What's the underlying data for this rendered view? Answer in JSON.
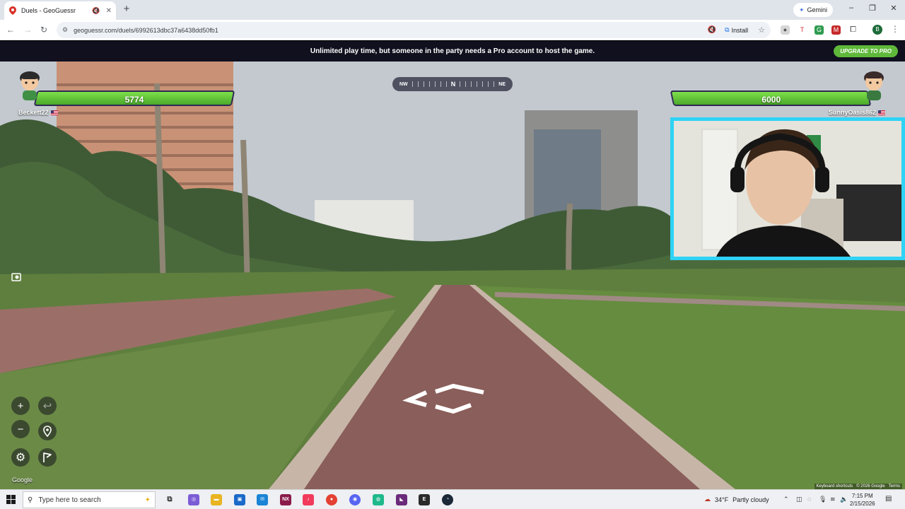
{
  "browser": {
    "tab_title": "Duels - GeoGuessr",
    "new_tab": "+",
    "gemini_label": "Gemini",
    "url": "geoguessr.com/duels/6992613dbc37a6438dd50fb1",
    "install_label": "Install",
    "profile_initial": "B"
  },
  "banner": {
    "message": "Unlimited play time, but someone in the party needs a Pro account to host the game.",
    "upgrade_label": "UPGRADE TO PRO"
  },
  "compass": {
    "left": "NW",
    "center": "N",
    "right": "NE"
  },
  "players": {
    "left": {
      "name": "Beckett22",
      "health": "5774"
    },
    "right": {
      "name": "SunnyOasis862",
      "health": "6000"
    }
  },
  "map_controls": {
    "zoom_in": "+",
    "zoom_out": "−",
    "undo": "↩"
  },
  "footer": {
    "google_mark": "Google",
    "keyboard_shortcuts": "Keyboard shortcuts",
    "copyright": "© 2026 Google",
    "terms": "Terms"
  },
  "taskbar": {
    "search_placeholder": "Type here to search",
    "weather_temp": "34°F",
    "weather_desc": "Partly cloudy",
    "time": "7:15 PM",
    "date": "2/15/2026"
  },
  "colors": {
    "banner_bg": "#10101e",
    "upgrade_green": "#5fb83a",
    "health_green": "#5fc234",
    "webcam_border": "#2ed3f5"
  }
}
